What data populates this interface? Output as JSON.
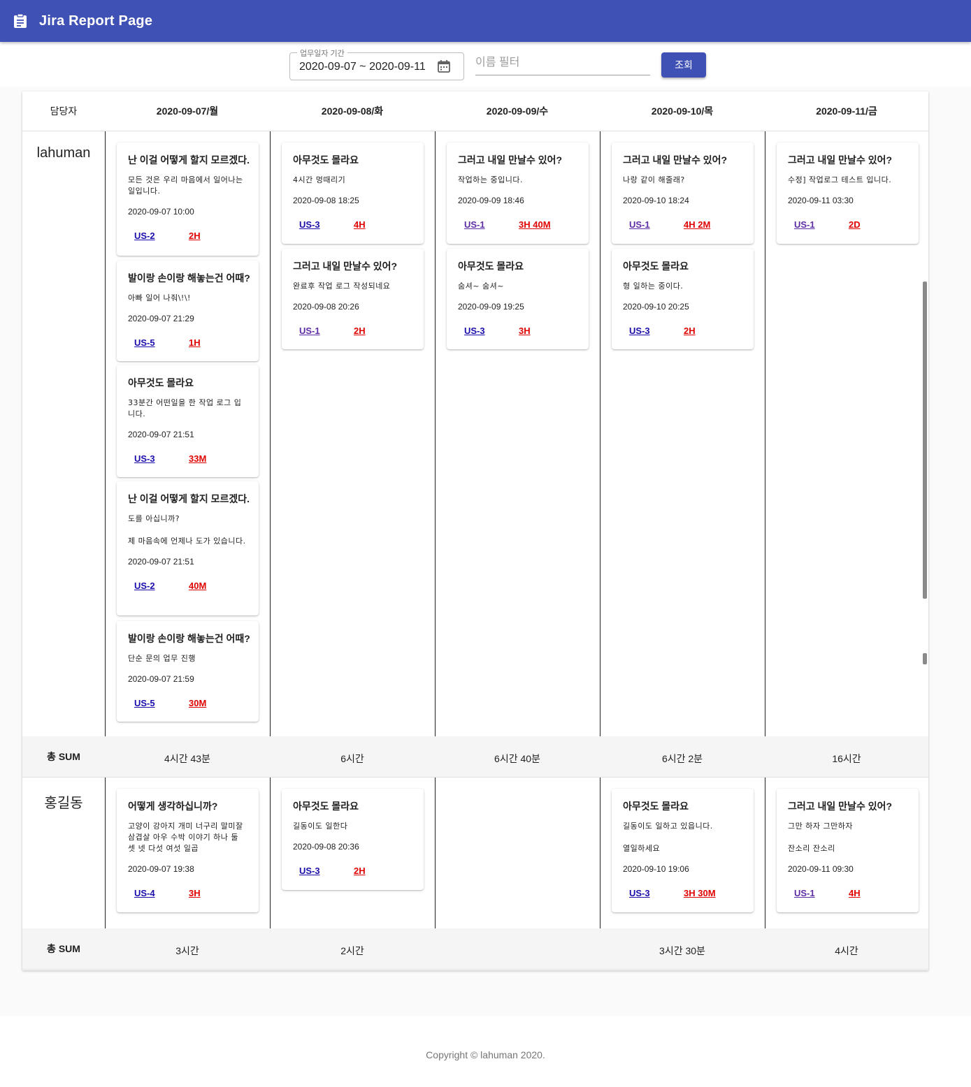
{
  "app": {
    "title": "Jira Report Page",
    "logo_icon": "clipboard-icon",
    "bar_color": "#3f51b5"
  },
  "filters": {
    "date_label": "업무일자 기간",
    "date_value": "2020-09-07 ~ 2020-09-11",
    "name_placeholder": "이름 필터",
    "search_label": "조회"
  },
  "table": {
    "owner_header": "담당자",
    "days": [
      "2020-09-07/월",
      "2020-09-08/화",
      "2020-09-09/수",
      "2020-09-10/목",
      "2020-09-11/금"
    ],
    "sum_label": "총 SUM"
  },
  "users": [
    {
      "name": "lahuman",
      "sums": [
        "4시간 43분",
        "6시간",
        "6시간 40분",
        "6시간 2분",
        "16시간"
      ],
      "days": [
        [
          {
            "title": "난 이걸 어떻게 할지 모르겠다.",
            "desc": [
              "모든 것은 우리 마음에서 일어나는 일입니다."
            ],
            "datetime": "2020-09-07 10:00",
            "key": "US-2",
            "time": "2H"
          },
          {
            "title": "발이랑 손이랑 해놓는건 어때?",
            "desc": [
              "아빠 일어 나줘\\!\\!"
            ],
            "datetime": "2020-09-07 21:29",
            "key": "US-5",
            "time": "1H"
          },
          {
            "title": "아무것도 몰라요",
            "desc": [
              "33분간 어떤일을 한 작업 로그 입니다."
            ],
            "datetime": "2020-09-07 21:51",
            "key": "US-3",
            "time": "33M"
          },
          {
            "title": "난 이걸 어떻게 할지 모르겠다.",
            "desc": [
              "도를 아십니까?",
              "제 마음속에 언제나 도가 있습니다."
            ],
            "datetime": "2020-09-07 21:51",
            "key": "US-2",
            "time": "40M"
          },
          {
            "title": "발이랑 손이랑 해놓는건 어때?",
            "desc": [
              "단순 문의 업무 진행"
            ],
            "datetime": "2020-09-07 21:59",
            "key": "US-5",
            "time": "30M"
          }
        ],
        [
          {
            "title": "아무것도 몰라요",
            "desc": [
              "4시간 멍때리기"
            ],
            "datetime": "2020-09-08 18:25",
            "key": "US-3",
            "time": "4H"
          },
          {
            "title": "그러고 내일 만날수 있어?",
            "desc": [
              "완료후 작업 로그 작성되네요"
            ],
            "datetime": "2020-09-08 20:26",
            "key": "US-1",
            "time": "2H"
          }
        ],
        [
          {
            "title": "그러고 내일 만날수 있어?",
            "desc": [
              "작업하는 중입니다."
            ],
            "datetime": "2020-09-09 18:46",
            "key": "US-1",
            "time": "3H 40M"
          },
          {
            "title": "아무것도 몰라요",
            "desc": [
              "숨셔~ 숨셔~"
            ],
            "datetime": "2020-09-09 19:25",
            "key": "US-3",
            "time": "3H"
          }
        ],
        [
          {
            "title": "그러고 내일 만날수 있어?",
            "desc": [
              "나랑 같이 해줄래?"
            ],
            "datetime": "2020-09-10 18:24",
            "key": "US-1",
            "time": "4H 2M"
          },
          {
            "title": "아무것도 몰라요",
            "desc": [
              "형 일하는 중이다."
            ],
            "datetime": "2020-09-10 20:25",
            "key": "US-3",
            "time": "2H"
          }
        ],
        [
          {
            "title": "그러고 내일 만날수 있어?",
            "desc": [
              "수정] 작업로그 테스트 입니다."
            ],
            "datetime": "2020-09-11 03:30",
            "key": "US-1",
            "time": "2D"
          }
        ]
      ]
    },
    {
      "name": "홍길동",
      "sums": [
        "3시간",
        "2시간",
        "",
        "3시간 30분",
        "4시간"
      ],
      "days": [
        [
          {
            "title": "어떻게 생각하십니까?",
            "desc": [
              "고양이 강아지 개미 너구리 말미잘 삼겹살 아우 수박 이야기 하나 둘 셋 넷 다섯 여섯 일곱"
            ],
            "datetime": "2020-09-07 19:38",
            "key": "US-4",
            "time": "3H"
          }
        ],
        [
          {
            "title": "아무것도 몰라요",
            "desc": [
              "길동이도 일한다"
            ],
            "datetime": "2020-09-08 20:36",
            "key": "US-3",
            "time": "2H"
          }
        ],
        [],
        [
          {
            "title": "아무것도 몰라요",
            "desc": [
              "길동이도 일하고 있읍니다.",
              "열일하세요"
            ],
            "datetime": "2020-09-10 19:06",
            "key": "US-3",
            "time": "3H 30M"
          }
        ],
        [
          {
            "title": "그러고 내일 만날수 있어?",
            "desc": [
              "그만 하자 그만하자",
              "잔소리 잔소리"
            ],
            "datetime": "2020-09-11 09:30",
            "key": "US-1",
            "time": "4H"
          }
        ]
      ]
    }
  ],
  "footer": {
    "copyright": "Copyright © lahuman 2020."
  },
  "colors": {
    "link": "#1a0dab",
    "visited_link": "#5e2ca5",
    "time": "#e00000"
  }
}
